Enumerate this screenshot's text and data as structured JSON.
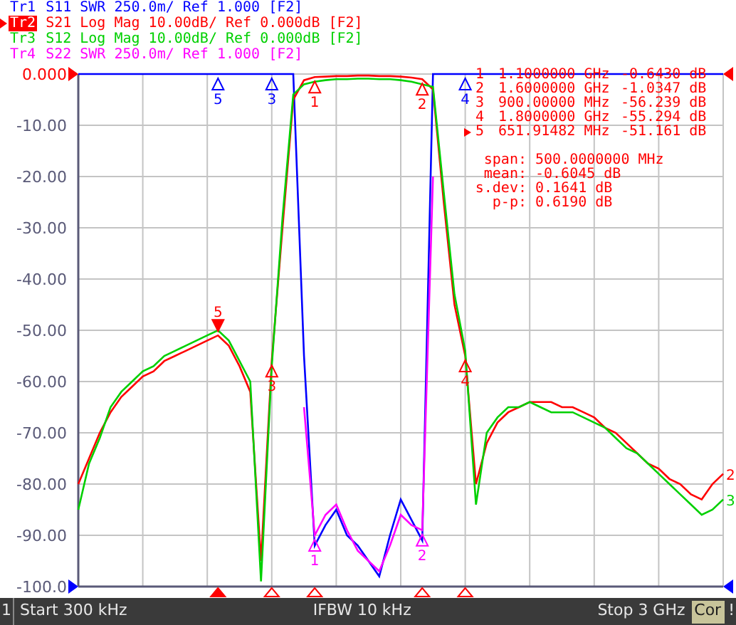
{
  "traces": [
    {
      "text": "S11 SWR 250.0m/ Ref 1.000 [F2]",
      "selected": false
    },
    {
      "text": "S21 Log Mag 10.00dB/ Ref 0.000dB [F2]",
      "selected": true
    },
    {
      "text": "S12 Log Mag 10.00dB/ Ref 0.000dB [F2]",
      "selected": false
    },
    {
      "text": "S22 SWR 250.0m/ Ref 1.000 [F2]",
      "selected": false
    }
  ],
  "chart_data": {
    "type": "line",
    "grid": true,
    "ylim": [
      -100,
      0
    ],
    "yticks": [
      {
        "value": 0,
        "label": "0.000"
      },
      {
        "value": -10,
        "label": "-10.00"
      },
      {
        "value": -20,
        "label": "-20.00"
      },
      {
        "value": -30,
        "label": "-30.00"
      },
      {
        "value": -40,
        "label": "-40.00"
      },
      {
        "value": -50,
        "label": "-50.00"
      },
      {
        "value": -60,
        "label": "-60.00"
      },
      {
        "value": -70,
        "label": "-70.00"
      },
      {
        "value": -80,
        "label": "-80.00"
      },
      {
        "value": -90,
        "label": "-90.00"
      },
      {
        "value": -100,
        "label": "-100.0"
      }
    ],
    "categories": [
      null,
      null,
      null,
      null,
      null,
      null,
      null,
      null,
      null,
      null,
      null,
      null,
      null,
      null,
      null,
      null,
      null,
      null,
      null,
      null,
      null,
      null,
      null,
      null,
      null,
      null,
      null,
      null,
      null,
      null,
      null,
      null,
      null,
      null,
      null,
      null,
      null,
      null,
      null,
      null,
      null,
      null,
      null,
      null,
      null,
      null,
      null,
      null,
      null,
      null,
      null,
      null,
      null,
      null,
      null,
      null,
      null,
      null,
      null,
      null,
      null
    ],
    "series": [
      {
        "name": "Tr1",
        "color": "#0000ff",
        "values": [
          0,
          0,
          0,
          0,
          0,
          0,
          0,
          0,
          0,
          0,
          0,
          0,
          0,
          0,
          0,
          0,
          0,
          0,
          0,
          0,
          0,
          -55,
          -92,
          -88,
          -85,
          -90,
          -92,
          -95,
          -98,
          -90,
          -83,
          -87,
          -91,
          0,
          0,
          0,
          0,
          0,
          0,
          0,
          0,
          0,
          0,
          0,
          0,
          0,
          0,
          0,
          0,
          0,
          0,
          0,
          0,
          0,
          0,
          0,
          0,
          0,
          0,
          0,
          0
        ]
      },
      {
        "name": "Tr2",
        "color": "#ff0000",
        "values": [
          -80,
          -75,
          -70,
          -66,
          -63,
          -61,
          -59,
          -58,
          -56,
          -55,
          -54,
          -53,
          -52,
          -51,
          -53,
          -57,
          -62,
          -95,
          -56,
          -30,
          -5,
          -1.2,
          -0.6,
          -0.5,
          -0.4,
          -0.4,
          -0.3,
          -0.3,
          -0.4,
          -0.4,
          -0.5,
          -0.7,
          -1,
          -3,
          -25,
          -45,
          -55,
          -80,
          -72,
          -68,
          -66,
          -65,
          -64,
          -64,
          -64,
          -65,
          -65,
          -66,
          -67,
          -69,
          -70,
          -72,
          -74,
          -76,
          -77,
          -79,
          -80,
          -82,
          -83,
          -80,
          -78
        ]
      },
      {
        "name": "Tr3",
        "color": "#00d000",
        "values": [
          -85,
          -76,
          -71,
          -65,
          -62,
          -60,
          -58,
          -57,
          -55,
          -54,
          -53,
          -52,
          -51,
          -50,
          -52,
          -56,
          -60,
          -99,
          -57,
          -28,
          -4,
          -2,
          -1.5,
          -1.2,
          -1,
          -1,
          -0.9,
          -0.9,
          -1,
          -1,
          -1.2,
          -1.5,
          -2,
          -2.5,
          -23,
          -43,
          -54,
          -84,
          -70,
          -67,
          -65,
          -65,
          -64,
          -65,
          -66,
          -66,
          -66,
          -67,
          -68,
          -69,
          -71,
          -73,
          -74,
          -76,
          -78,
          -80,
          -82,
          -84,
          -86,
          -85,
          -83
        ]
      },
      {
        "name": "Tr4",
        "color": "#ff00ff",
        "values": [
          null,
          null,
          null,
          null,
          null,
          null,
          null,
          null,
          null,
          null,
          null,
          null,
          null,
          null,
          null,
          null,
          null,
          null,
          null,
          null,
          null,
          -65,
          -90,
          -86,
          -84,
          -89,
          -93,
          -95,
          -97,
          -92,
          -86,
          -88,
          -89,
          -20,
          null,
          null,
          null,
          null,
          null,
          null,
          null,
          null,
          null,
          null,
          null,
          null,
          null,
          null,
          null,
          null,
          null,
          null,
          null,
          null,
          null,
          null,
          null,
          null,
          null,
          null,
          null
        ]
      }
    ]
  },
  "trace_markers": {
    "trace_0": {
      "point_13": {
        "text": "5",
        "selected": false
      },
      "point_18": {
        "text": "3",
        "selected": false
      },
      "point_36": {
        "text": "4",
        "selected": false
      }
    },
    "trace_1": {
      "point_13": {
        "text": "5",
        "selected": true
      },
      "point_18": {
        "text": "3",
        "selected": false
      },
      "point_22": {
        "text": "1",
        "selected": false
      },
      "point_32": {
        "text": "2",
        "selected": false
      },
      "point_36": {
        "text": "4",
        "selected": false
      }
    },
    "trace_3": {
      "point_22": {
        "text": "1",
        "selected": false
      },
      "point_32": {
        "text": "2",
        "selected": false
      }
    }
  },
  "trace_end_labels": {
    "trace_1": "2",
    "trace_2": "3"
  },
  "marker_table": [
    {
      "number": "1",
      "stimulus": "1.1000000 GHz",
      "response": "-0.6430 dB",
      "selected": false
    },
    {
      "number": "2",
      "stimulus": "1.6000000 GHz",
      "response": "-1.0347 dB",
      "selected": false
    },
    {
      "number": "3",
      "stimulus": "900.00000 MHz",
      "response": "-56.239 dB",
      "selected": false
    },
    {
      "number": "4",
      "stimulus": "1.8000000 GHz",
      "response": "-55.294 dB",
      "selected": false
    },
    {
      "number": "5",
      "stimulus": "651.91482 MHz",
      "response": "-51.161 dB",
      "selected": true
    }
  ],
  "statistics": [
    {
      "label": "span:",
      "value": "500.0000000 MHz"
    },
    {
      "label": "mean:",
      "value": "-0.6045 dB"
    },
    {
      "label": "s.dev:",
      "value": "0.1641 dB"
    },
    {
      "label": "p-p:",
      "value": "0.6190 dB"
    }
  ],
  "status_bar": {
    "channel": "1",
    "start": "Start 300 kHz",
    "ifbw": "IFBW 10 kHz",
    "stop": "Stop 3 GHz",
    "correction": "Cor",
    "warning": "!"
  }
}
